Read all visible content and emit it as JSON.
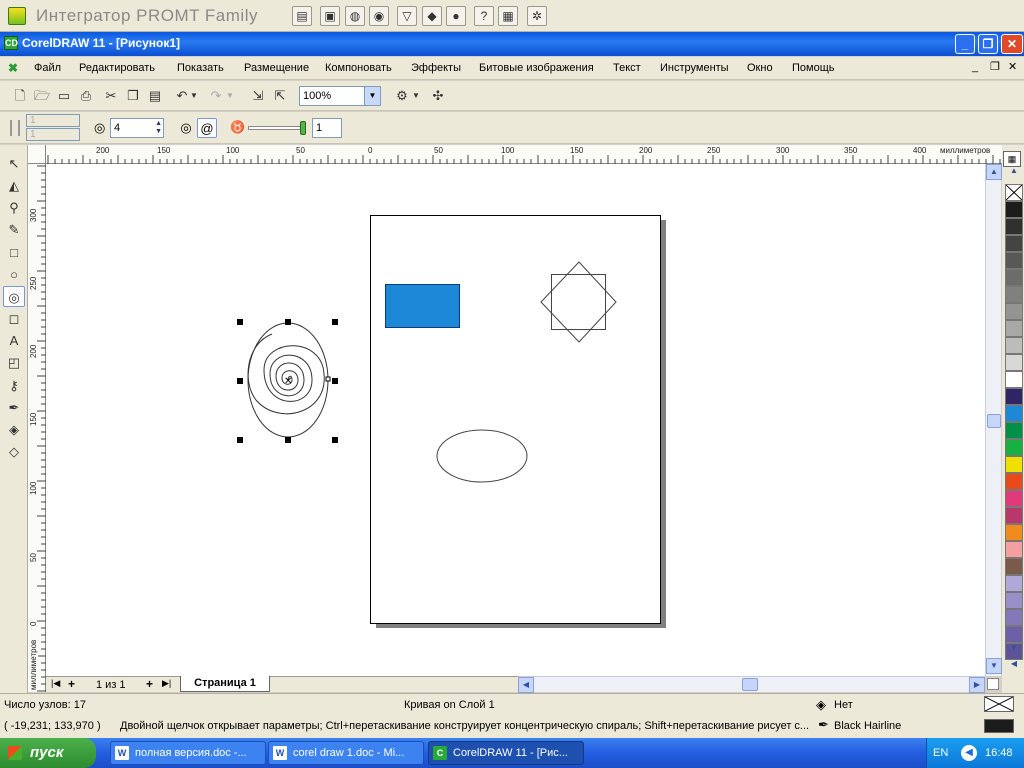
{
  "promt": {
    "title": "Интегратор PROMT Family",
    "buttons": [
      "book-icon",
      "folder-icon",
      "globe-icon",
      "globe-search-icon",
      "filter-icon",
      "dictionary-icon",
      "world-icon",
      "help-icon",
      "translate-icon",
      "settings-icon"
    ]
  },
  "window": {
    "title": "CorelDRAW 11 - [Рисунок1]",
    "app_icon": "CD",
    "minimize": "_",
    "restore": "❐",
    "close": "✕"
  },
  "menu": {
    "items": [
      "Файл",
      "Редактировать",
      "Показать",
      "Размещение",
      "Компоновать",
      "Эффекты",
      "Битовые изображения",
      "Текст",
      "Инструменты",
      "Окно",
      "Помощь"
    ]
  },
  "toolbar": {
    "zoom_value": "100%"
  },
  "property_bar": {
    "spiral_revolutions": "4",
    "expansion_value": "1",
    "disabled_value_1": "1",
    "disabled_value_2": "1"
  },
  "rulers": {
    "units": "миллиметров",
    "h_labels": [
      "200",
      "150",
      "100",
      "50",
      "0",
      "50",
      "100",
      "150",
      "200",
      "250",
      "300",
      "350",
      "400"
    ],
    "v_labels": [
      "300",
      "250",
      "200",
      "150",
      "100",
      "50",
      "0"
    ]
  },
  "page_nav": {
    "counter": "1 из 1",
    "tab": "Страница 1"
  },
  "palette": {
    "colors": [
      "#1c1c1c",
      "#303030",
      "#444444",
      "#585858",
      "#6c6c6c",
      "#808080",
      "#949494",
      "#a8a8a8",
      "#bcbcbc",
      "#d8d8d8",
      "#ffffff",
      "#2e2466",
      "#1e88d8",
      "#009048",
      "#18b040",
      "#f0e000",
      "#e84a1a",
      "#e03a7a",
      "#b8386c",
      "#f08c1e",
      "#f4a0a0",
      "#7a5a4a",
      "#b0a8d8",
      "#9890c8",
      "#8478b8",
      "#6c60a8",
      "#5c5498"
    ]
  },
  "status": {
    "nodes": "Число узлов: 17",
    "object": "Кривая on Слой 1",
    "coords": "( -19,231; 133,970 )",
    "hint": "Двойной щелчок открывает параметры; Ctrl+перетаскивание конструирует концентрическую спираль; Shift+перетаскивание рисует с...",
    "fill_label": "Нет",
    "outline_label": "Black  Hairline"
  },
  "taskbar": {
    "start": "пуск",
    "tasks": [
      {
        "label": "полная версия.doc -...",
        "icon": "W"
      },
      {
        "label": "corel draw 1.doc - Mi...",
        "icon": "W"
      },
      {
        "label": "CorelDRAW 11 - [Рис...",
        "icon": "C"
      }
    ],
    "lang": "EN",
    "time": "16:48"
  },
  "colors": {
    "rectangle_fill": "#1e88d8"
  }
}
